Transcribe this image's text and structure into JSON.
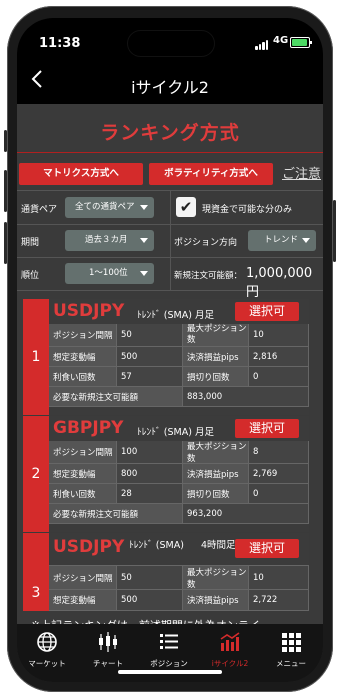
{
  "status": {
    "time": "11:38",
    "network": "4G"
  },
  "nav": {
    "title": "iサイクル2",
    "back_icon": "chevron-left-icon"
  },
  "header": {
    "title": "ランキング方式",
    "accent": "#d42b2b"
  },
  "buttons": {
    "matrix": "マトリクス方式へ",
    "volatility": "ボラティリティ方式へ",
    "caution": "ご注意"
  },
  "filters": {
    "currency_label": "通貨ペア",
    "currency_value": "全ての通貨ペア",
    "cash_only_label": "現資金で可能な分のみ",
    "cash_only_checked": true,
    "period_label": "期間",
    "period_value": "過去３カ月",
    "direction_label": "ポジション方向",
    "direction_value": "トレンド",
    "rank_label": "順位",
    "rank_value": "1〜100位",
    "available_label": "新規注文可能額：",
    "available_value": "1,000,000円"
  },
  "labels": {
    "position_interval": "ポジション間隔",
    "max_positions": "最大ポジション数",
    "expected_range": "想定変動幅",
    "settlement_pips": "決済損益pips",
    "profit_count": "利食い回数",
    "loss_count": "損切り回数",
    "required_amount": "必要な新規注文可能額",
    "select": "選択可"
  },
  "rankings": [
    {
      "rank": "1",
      "pair": "USDJPY",
      "trend": "ﾄﾚﾝﾄﾞ (SMA)",
      "period": "月足",
      "position_interval": "50",
      "max_positions": "10",
      "expected_range": "500",
      "settlement_pips": "2,816",
      "profit_count": "57",
      "loss_count": "0",
      "required_amount": "883,000"
    },
    {
      "rank": "2",
      "pair": "GBPJPY",
      "trend": "ﾄﾚﾝﾄﾞ (SMA)",
      "period": "月足",
      "position_interval": "100",
      "max_positions": "8",
      "expected_range": "800",
      "settlement_pips": "2,769",
      "profit_count": "28",
      "loss_count": "0",
      "required_amount": "963,200"
    },
    {
      "rank": "3",
      "pair": "USDJPY",
      "trend": "ﾄﾚﾝﾄﾞ (SMA)",
      "period": "4時間足",
      "position_interval": "50",
      "max_positions": "10",
      "expected_range": "500",
      "settlement_pips": "2,722"
    }
  ],
  "notice": "※上記ランキングは、前述期間に外為オンライ",
  "tabs": [
    {
      "label": "マーケット",
      "icon": "globe-icon",
      "active": false
    },
    {
      "label": "チャート",
      "icon": "candlestick-icon",
      "active": false
    },
    {
      "label": "ポジション",
      "icon": "list-icon",
      "active": false
    },
    {
      "label": "iサイクル2",
      "icon": "cycle-chart-icon",
      "active": true
    },
    {
      "label": "メニュー",
      "icon": "grid-menu-icon",
      "active": false
    }
  ]
}
